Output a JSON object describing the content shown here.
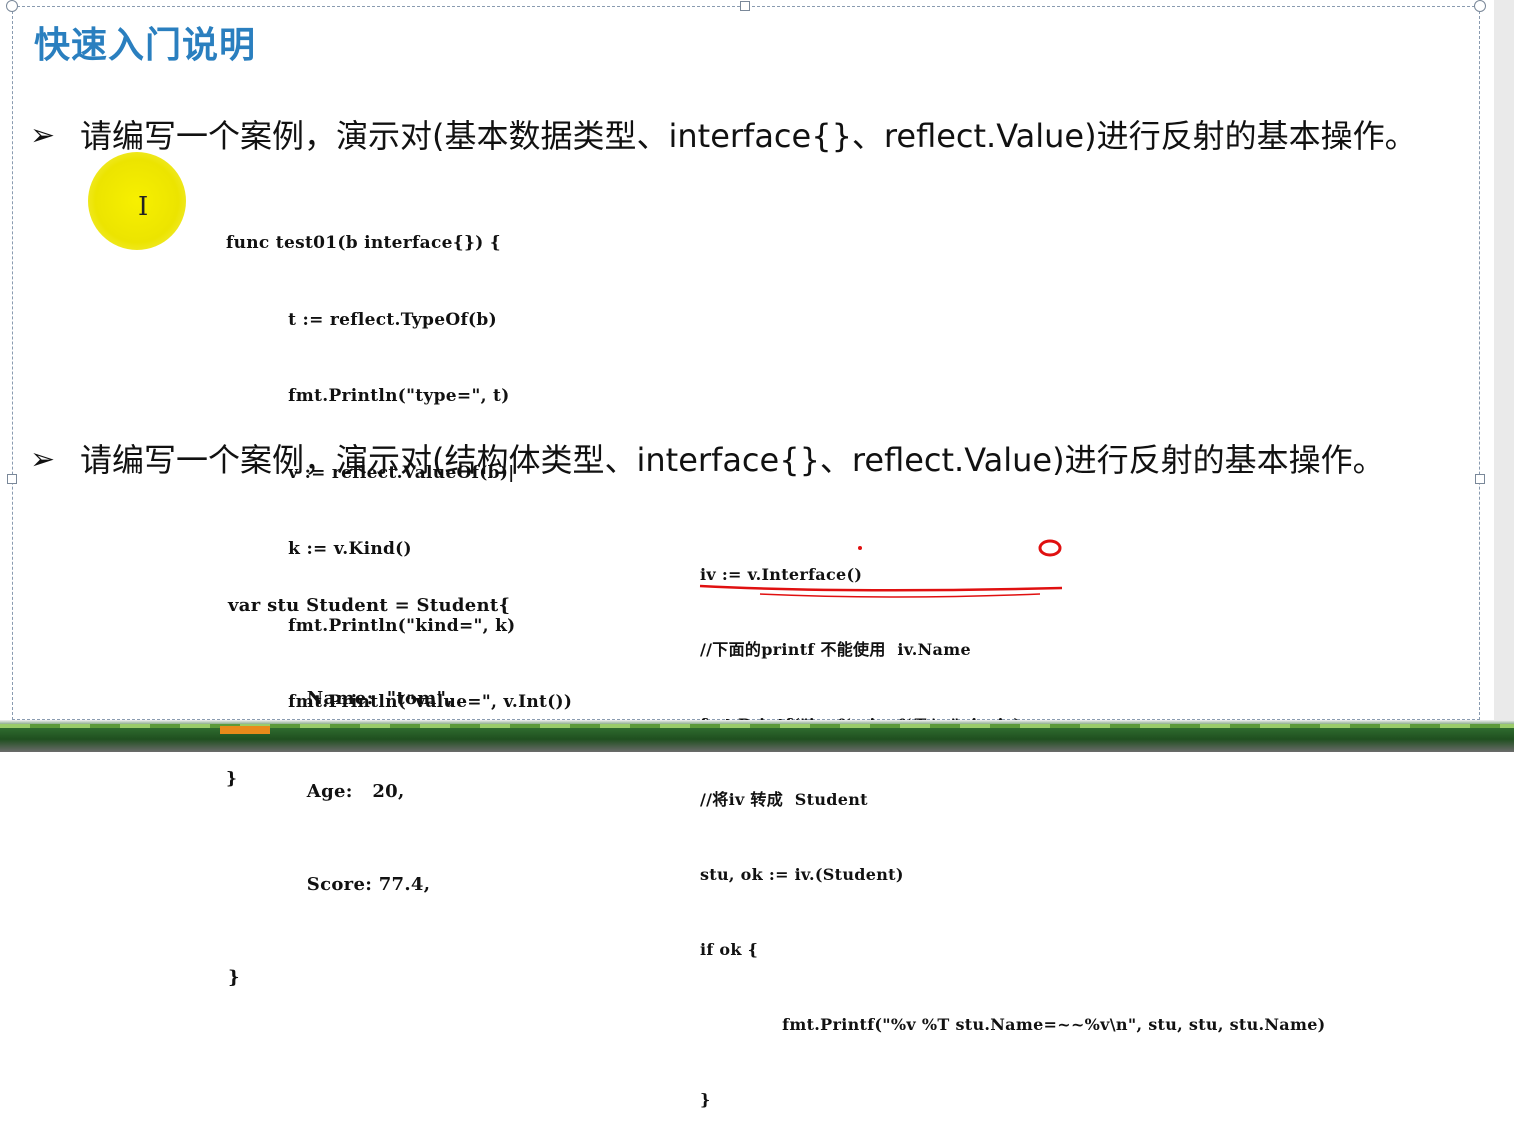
{
  "slide": {
    "title": "快速入门说明",
    "bullet_glyph": "➢",
    "bullets": [
      {
        "text": "请编写一个案例，演示对(基本数据类型、interface{}、reflect.Value)进行反射的基本操作。"
      },
      {
        "text": "请编写一个案例，演示对(结构体类型、interface{}、reflect.Value)进行反射的基本操作。"
      }
    ],
    "code1": [
      "func test01(b interface{}) {",
      "          t := reflect.TypeOf(b)",
      "          fmt.Println(\"type=\", t)",
      "          v := reflect.ValueOf(b)|",
      "          k := v.Kind()",
      "          fmt.Println(\"kind=\", k)",
      "          fmt.Println(\"value=\", v.Int())",
      "}"
    ],
    "code2": [
      "var stu Student = Student{",
      "            Name:  \"tom\",",
      "            Age:   20,",
      "            Score: 77.4,",
      "}"
    ],
    "code3": [
      "iv := v.Interface()",
      "//下面的printf 不能使用  iv.Name",
      "fmt.Printf(\"iv=%v iv=%T \\n\", iv, iv)",
      "//将iv 转成  Student",
      "stu, ok := iv.(Student)",
      "if ok {",
      "              fmt.Printf(\"%v %T stu.Name=~~%v\\n\", stu, stu, stu.Name)",
      "}"
    ],
    "cursor_glyph": "I",
    "annotation_color": "#e01010",
    "title_color": "#2a7fbf"
  }
}
